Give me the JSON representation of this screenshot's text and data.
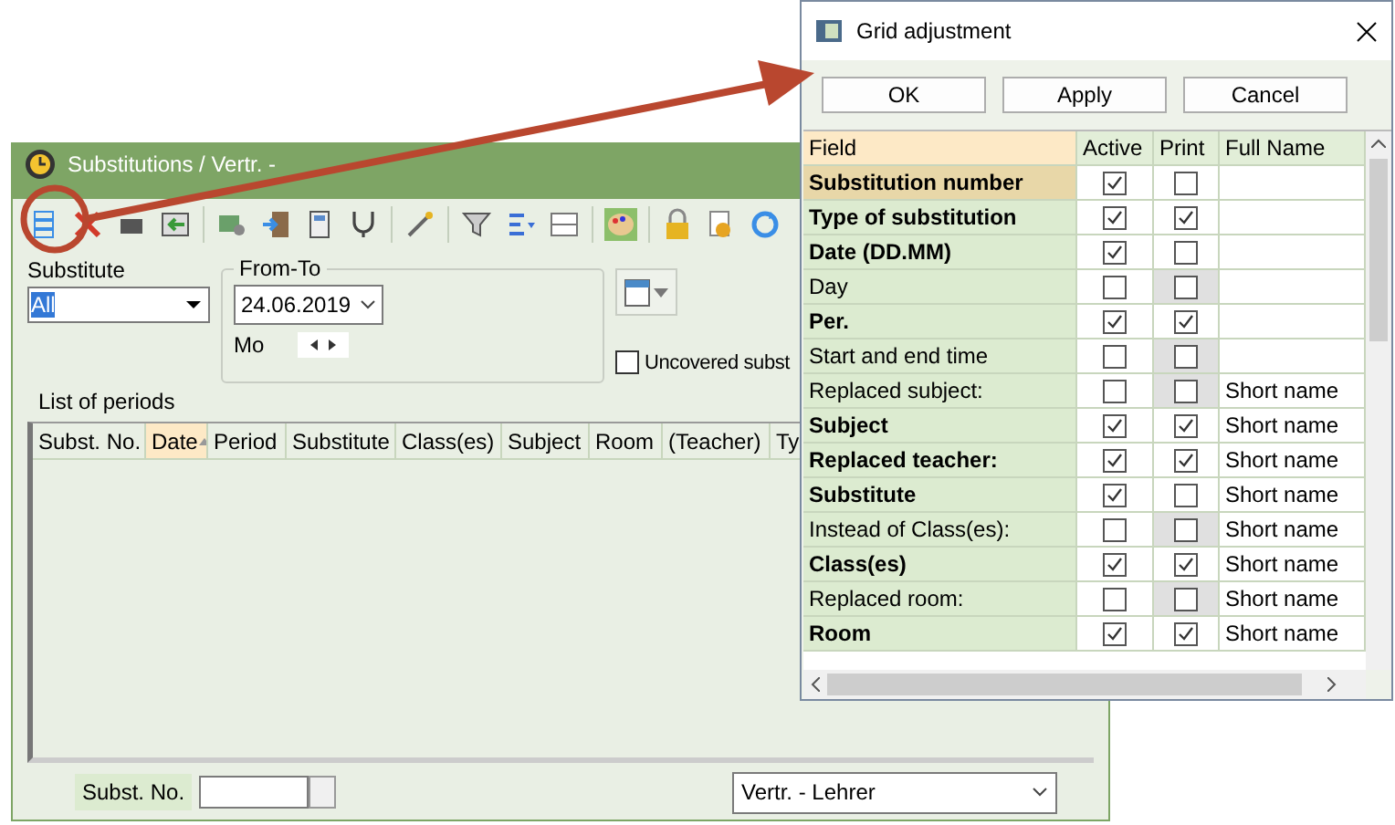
{
  "main_window": {
    "title": "Substitutions / Vertr. -",
    "substitute": {
      "label": "Substitute",
      "value": "All"
    },
    "date_range": {
      "label": "From-To",
      "date": "24.06.2019",
      "weekday": "Mo"
    },
    "uncovered": {
      "label": "Uncovered subst",
      "checked": false
    },
    "list_title": "List of periods",
    "columns": [
      {
        "label": "Subst. No.",
        "sorted": false
      },
      {
        "label": "Date",
        "sorted": true
      },
      {
        "label": "Period",
        "sorted": false
      },
      {
        "label": "Substitute",
        "sorted": false
      },
      {
        "label": "Class(es)",
        "sorted": false
      },
      {
        "label": "Subject",
        "sorted": false
      },
      {
        "label": "Room",
        "sorted": false
      },
      {
        "label": "(Teacher)",
        "sorted": false
      },
      {
        "label": "Ty",
        "sorted": false
      }
    ],
    "footer": {
      "label": "Subst. No.",
      "dropdown": "Vertr. - Lehrer"
    }
  },
  "dialog": {
    "title": "Grid adjustment",
    "buttons": [
      "OK",
      "Apply",
      "Cancel"
    ],
    "columns": [
      "Field",
      "Active",
      "Print",
      "Full Name"
    ],
    "rows": [
      {
        "field": "Substitution number",
        "bold": true,
        "selected": true,
        "active": true,
        "print": false,
        "print_disabled": false
      },
      {
        "field": "Type of substitution",
        "bold": true,
        "selected": false,
        "active": true,
        "print": true,
        "print_disabled": false
      },
      {
        "field": "Date (DD.MM)",
        "bold": true,
        "selected": false,
        "active": true,
        "print": false,
        "print_disabled": false
      },
      {
        "field": "Day",
        "bold": false,
        "selected": false,
        "active": false,
        "print": false,
        "print_disabled": true
      },
      {
        "field": "Per.",
        "bold": true,
        "selected": false,
        "active": true,
        "print": true,
        "print_disabled": false
      },
      {
        "field": "Start and end time",
        "bold": false,
        "selected": false,
        "active": false,
        "print": false,
        "print_disabled": true
      },
      {
        "field": "Replaced subject:",
        "bold": false,
        "selected": false,
        "active": false,
        "print": false,
        "print_disabled": true,
        "full_name": "Short name"
      },
      {
        "field": "Subject",
        "bold": true,
        "selected": false,
        "active": true,
        "print": true,
        "print_disabled": false,
        "full_name": "Short name"
      },
      {
        "field": "Replaced teacher:",
        "bold": true,
        "selected": false,
        "active": true,
        "print": true,
        "print_disabled": false,
        "full_name": "Short name"
      },
      {
        "field": "Substitute",
        "bold": true,
        "selected": false,
        "active": true,
        "print": false,
        "print_disabled": false,
        "full_name": "Short name"
      },
      {
        "field": "Instead of Class(es):",
        "bold": false,
        "selected": false,
        "active": false,
        "print": false,
        "print_disabled": true,
        "full_name": "Short name"
      },
      {
        "field": "Class(es)",
        "bold": true,
        "selected": false,
        "active": true,
        "print": true,
        "print_disabled": false,
        "full_name": "Short name"
      },
      {
        "field": "Replaced room:",
        "bold": false,
        "selected": false,
        "active": false,
        "print": false,
        "print_disabled": true,
        "full_name": "Short name"
      },
      {
        "field": "Room",
        "bold": true,
        "selected": false,
        "active": true,
        "print": true,
        "print_disabled": false,
        "full_name": "Short name"
      }
    ]
  }
}
